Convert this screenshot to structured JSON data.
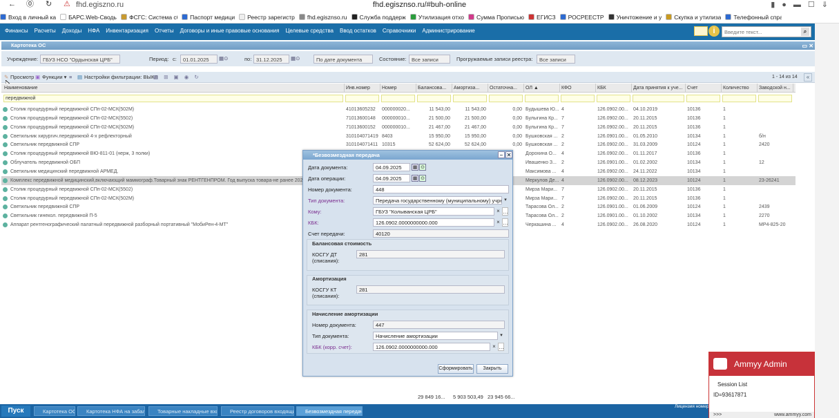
{
  "browser": {
    "back": "←",
    "forward": "⓪",
    "reload": "↻",
    "warn": "⚠",
    "host": "fhd.egiszno.ru",
    "url": "fhd.egisznso.ru/#buh-online",
    "bookmarks": [
      {
        "label": "Вход в личный ка",
        "color": "#2d6ad1"
      },
      {
        "label": "БАРС.Web-Своды",
        "color": "#ffffff"
      },
      {
        "label": "ФСГС: Система сб",
        "color": "#c89a30"
      },
      {
        "label": "Паспорт медици",
        "color": "#2d6ad1"
      },
      {
        "label": "Реестр зарегистр",
        "color": "#eeeeee"
      },
      {
        "label": "fhd.egisznso.ru",
        "color": "#888888"
      },
      {
        "label": "Служба поддерж",
        "color": "#222222"
      },
      {
        "label": "Утилизация отхо",
        "color": "#2a9d3c"
      },
      {
        "label": "Сумма Прописью",
        "color": "#d13a8a"
      },
      {
        "label": "ЕГИСЗ",
        "color": "#c33"
      },
      {
        "label": "РОСРЕЕСТР",
        "color": "#2d6ad1"
      },
      {
        "label": "Уничтожение и у",
        "color": "#333"
      },
      {
        "label": "Скупка и утилиза",
        "color": "#c99a20"
      },
      {
        "label": "Телефонный спра",
        "color": "#2d6ad1"
      }
    ]
  },
  "appnav": {
    "menu": [
      "Финансы",
      "Расчеты",
      "Доходы",
      "НФА",
      "Инвентаризация",
      "Отчеты",
      "Договоры и иные правовые основания",
      "Целевые средства",
      "Ввод остатков",
      "Справочники",
      "Администрирование"
    ],
    "search_placeholder": "Введите текст..."
  },
  "panel": {
    "title": "Картотека ОС",
    "filters": {
      "institution_label": "Учреждение:",
      "institution_value": "ГБУЗ НСО \"Ордынская ЦРБ\"",
      "period_label": "Период:",
      "from_label": "с:",
      "from_value": "01.01.2025",
      "to_label": "по:",
      "to_value": "31.12.2025",
      "date_mode": "По дате документа",
      "state_label": "Состояние:",
      "state_value": "Все записи",
      "loaded_label": "Прогружаемые записи реестра:",
      "loaded_value": "Все записи"
    },
    "toolbar": {
      "view": "Просмотр",
      "functions": "Функции ▾",
      "filter_settings": "Настройки фильтрации: ВЫКЛ"
    },
    "pager": "1 - 14 из 14",
    "columns": [
      "Наименование",
      "Инв.номер",
      "Номер",
      "Балансова...",
      "Амортиза...",
      "Остаточна...",
      "ОЛ ▲",
      "КФО",
      "КБК",
      "Дата принятия к уче...",
      "Счет",
      "Количество",
      "Заводской н..."
    ],
    "filter_text": "передвижной",
    "rows": [
      [
        "Столик процедурный передвижной СПп-02-МСК(502М)",
        "41013605232",
        "000000020...",
        "11 543,00",
        "11 543,00",
        "0,00",
        "Будышева Ю...",
        "4",
        "126.0902.00...",
        "04.10.2019",
        "10136",
        "1",
        ""
      ],
      [
        "Столик процедурный передвижной СПп-02-МСК(5502)",
        "71013600148",
        "000000010...",
        "21 500,00",
        "21 500,00",
        "0,00",
        "Булыгина Кр...",
        "7",
        "126.0902.00...",
        "20.11.2015",
        "10136",
        "1",
        ""
      ],
      [
        "Столик процедурный передвижной СПп-02-МСК(502М)",
        "71013600152",
        "000000010...",
        "21 467,00",
        "21 467,00",
        "0,00",
        "Булыгина Кр...",
        "7",
        "126.0902.00...",
        "20.11.2015",
        "10136",
        "1",
        ""
      ],
      [
        "Светильник хирургич.передвижной 4-х рефлекторный",
        "310104071419",
        "8403",
        "15 950,00",
        "15 950,00",
        "0,00",
        "Бушковская ...",
        "2",
        "126.0901.00...",
        "01.05.2010",
        "10134",
        "1",
        "б/н"
      ],
      [
        "Светильник передвижной СПР",
        "310104071411",
        "10315",
        "52 624,00",
        "52 624,00",
        "0,00",
        "Бушковская ...",
        "2",
        "126.0902.00...",
        "31.03.2009",
        "10124",
        "1",
        "2420"
      ],
      [
        "Столик процедурный передвижной ВЮ-811-01 (нерж, 3 полки)",
        "",
        "",
        "",
        "",
        "",
        "Дорохина О...",
        "4",
        "126.0902.00...",
        "01.11.2017",
        "10136",
        "1",
        ""
      ],
      [
        "Облучатель передвижной ОБП",
        "",
        "",
        "",
        "",
        "",
        "Ивашенко З...",
        "2",
        "126.0901.00...",
        "01.02.2002",
        "10134",
        "1",
        "12"
      ],
      [
        "Светильник медицинский передвижной АРМЕД.",
        "",
        "",
        "",
        "",
        "",
        "Максимова ...",
        "4",
        "126.0902.00...",
        "24.11.2022",
        "10134",
        "1",
        ""
      ],
      [
        "Комплекс передвижной медицинский,включающий маммограф.Товарный знак РЕНТГЕНПРОМ. Год выпуска товара-не ранее 2022г.",
        "",
        "",
        "",
        "",
        "",
        "Меркулов Де...",
        "4",
        "126.0902.00...",
        "08.12.2023",
        "10124",
        "1",
        "23-26241"
      ],
      [
        "Столик процедурный передвижной СПп-02-МСК(5502)",
        "",
        "",
        "",
        "",
        "",
        "Мирза Мари...",
        "7",
        "126.0902.00...",
        "20.11.2015",
        "10136",
        "1",
        ""
      ],
      [
        "Столик процедурный передвижной СПп-02-МСК(502М)",
        "",
        "",
        "",
        "",
        "",
        "Мирза Мари...",
        "7",
        "126.0902.00...",
        "20.11.2015",
        "10136",
        "1",
        ""
      ],
      [
        "Светильник передвижной СПР",
        "",
        "",
        "",
        "",
        "",
        "Тарасова Ол...",
        "2",
        "126.0901.00...",
        "01.06.2009",
        "10124",
        "1",
        "2439"
      ],
      [
        "Светильник гинекол. передвижной П-5",
        "",
        "",
        "",
        "",
        "",
        "Тарасова Ол...",
        "2",
        "126.0901.00...",
        "01.10.2002",
        "10134",
        "1",
        "2270"
      ],
      [
        "Аппарат рентгенографический палатный передвижной разборный портативный \"МобиРен-4-МТ\"",
        "",
        "",
        "",
        "",
        "",
        "Черкашина ...",
        "4",
        "126.0902.00...",
        "26.08.2020",
        "10124",
        "1",
        "МР4-825-20"
      ]
    ],
    "totals": [
      "29 849 16...",
      "5 903 503,49",
      "23 945 66..."
    ]
  },
  "dialog": {
    "title": "*Безвозмездная передача",
    "doc_date_label": "Дата документа:",
    "doc_date": "04.09.2025",
    "op_date_label": "Дата операции:",
    "op_date": "04.09.2025",
    "doc_number_label": "Номер документа:",
    "doc_number": "448",
    "doc_type_label": "Тип документа:",
    "doc_type": "Передача государственному (муниципальному) учреж...",
    "to_label": "Кому:",
    "to_value": "ГБУЗ \"Колыванская ЦРБ\"",
    "kbk_label": "КБК:",
    "kbk_value": "126.0902.0000000000.000",
    "account_label": "Счет передачи:",
    "account_value": "40120",
    "balance_section": "Балансовая стоимость",
    "kosgu_dt_label": "КОСГУ ДТ (списания):",
    "kosgu_dt": "281",
    "amort_section": "Амортизация",
    "kosgu_kt_label": "КОСГУ КТ (списания):",
    "kosgu_kt": "281",
    "accrual_section": "Начисление амортизации",
    "accr_doc_number_label": "Номер документа:",
    "accr_doc_number": "447",
    "accr_doc_type_label": "Тип документа:",
    "accr_doc_type": "Начисление амортизации",
    "accr_kbk_label": "КБК (корр. счет):",
    "accr_kbk": "126.0902.0000000000.000",
    "form_button": "Сформировать",
    "close_button": "Закрыть"
  },
  "taskbar": {
    "start": "Пуск",
    "tasks": [
      "Картотека ОС",
      "Картотека НФА на забал...",
      "Товарные накладные вхо...",
      "Реестр договоров входящих",
      "Безвозмездная передача"
    ],
    "license": "Лицензия номер"
  },
  "ammyy": {
    "title": "Ammyy Admin",
    "session": "Session List",
    "id": "ID=93617871",
    "more": ">>>",
    "site": "www.ammyy.com"
  }
}
